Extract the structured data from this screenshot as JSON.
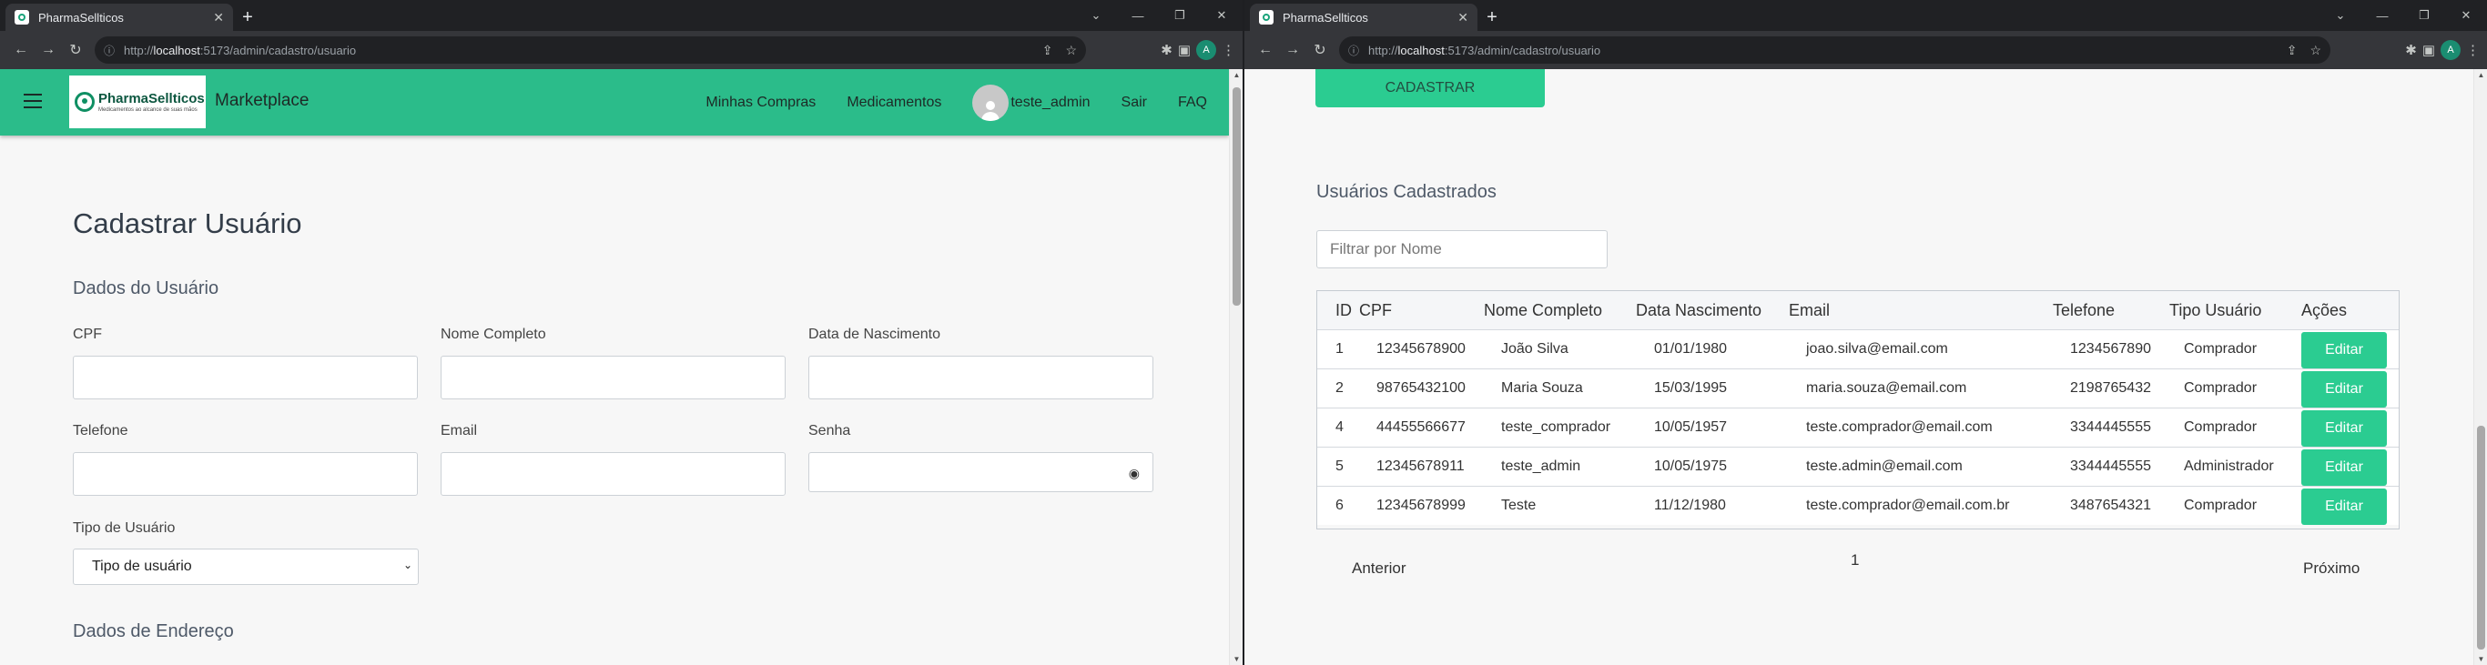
{
  "browser": {
    "tab_title": "PharmaSellticos",
    "url_scheme": "http://",
    "url_host": "localhost",
    "url_path": ":5173/admin/cadastro/usuario",
    "profile_initial": "A"
  },
  "navbar": {
    "logo_text": "PharmaSellticos",
    "logo_tagline": "Medicamentos ao alcance de suas mãos",
    "brand": "Marketplace",
    "links": [
      "Minhas Compras",
      "Medicamentos"
    ],
    "username": "teste_admin",
    "logout": "Sair",
    "faq": "FAQ"
  },
  "form": {
    "title": "Cadastrar Usuário",
    "section_user": "Dados do Usuário",
    "cpf_label": "CPF",
    "nome_label": "Nome Completo",
    "nasc_label": "Data de Nascimento",
    "tel_label": "Telefone",
    "email_label": "Email",
    "senha_label": "Senha",
    "tipo_label": "Tipo de Usuário",
    "tipo_selected": "Tipo de usuário",
    "section_address": "Dados de Endereço"
  },
  "list": {
    "submit_label": "CADASTRAR",
    "title": "Usuários Cadastrados",
    "filter_placeholder": "Filtrar por Nome",
    "columns": [
      "ID",
      "CPF",
      "Nome Completo",
      "Data Nascimento",
      "Email",
      "Telefone",
      "Tipo Usuário",
      "Ações"
    ],
    "rows": [
      {
        "id": "1",
        "cpf": "12345678900",
        "nome": "João Silva",
        "nasc": "01/01/1980",
        "email": "joao.silva@email.com",
        "tel": "1234567890",
        "tipo": "Comprador",
        "acao": "Editar"
      },
      {
        "id": "2",
        "cpf": "98765432100",
        "nome": "Maria Souza",
        "nasc": "15/03/1995",
        "email": "maria.souza@email.com",
        "tel": "2198765432",
        "tipo": "Comprador",
        "acao": "Editar"
      },
      {
        "id": "4",
        "cpf": "44455566677",
        "nome": "teste_comprador",
        "nasc": "10/05/1957",
        "email": "teste.comprador@email.com",
        "tel": "3344445555",
        "tipo": "Comprador",
        "acao": "Editar"
      },
      {
        "id": "5",
        "cpf": "12345678911",
        "nome": "teste_admin",
        "nasc": "10/05/1975",
        "email": "teste.admin@email.com",
        "tel": "3344445555",
        "tipo": "Administrador",
        "acao": "Editar"
      },
      {
        "id": "6",
        "cpf": "12345678999",
        "nome": "Teste",
        "nasc": "11/12/1980",
        "email": "teste.comprador@email.com.br",
        "tel": "3487654321",
        "tipo": "Comprador",
        "acao": "Editar"
      }
    ],
    "prev": "Anterior",
    "page": "1",
    "next": "Próximo"
  }
}
